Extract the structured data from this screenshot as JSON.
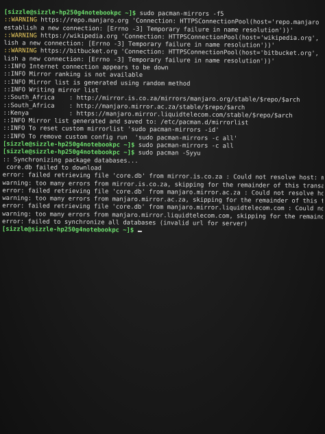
{
  "prompt": {
    "host": "[sizzle@sizzle-hp250g4notebookpc ~]$"
  },
  "commands": {
    "c1": "sudo pacman-mirrors -f5",
    "c2": "sudo pacman-mirrors -c all",
    "c3": "sudo pacman -Syyu"
  },
  "marks": {
    "warning": "::WARNING",
    "info": "::INFO",
    "sync": "::"
  },
  "l": {
    "w1": " https://repo.manjaro.org 'Connection: HTTPSConnectionPool(host='repo.manjaro",
    "w1b": "establish a new connection: [Errno -3] Temporary failure in name resolution'))'",
    "w2": " https://wikipedia.org 'Connection: HTTPSConnectionPool(host='wikipedia.org',",
    "w2b": "lish a new connection: [Errno -3] Temporary failure in name resolution'))'",
    "w3": " https://bitbucket.org 'Connection: HTTPSConnectionPool(host='bitbucket.org',",
    "w3b": "lish a new connection: [Errno -3] Temporary failure in name resolution'))'",
    "i1": " Internet connection appears to be down",
    "i2": " Mirror ranking is not available",
    "i3": " Mirror list is generated using random method",
    "i4": " Writing mirror list",
    "sa1": "::South_Africa    : http://mirror.is.co.za/mirrors/manjaro.org/stable/$repo/$arch",
    "sa2": "::South_Africa    : http://manjaro.mirror.ac.za/stable/$repo/$arch",
    "ke": "::Kenya           : https://manjaro.mirror.liquidtelecom.com/stable/$repo/$arch",
    "i5": " Mirror list generated and saved to: /etc/pacman.d/mirrorlist",
    "i6": " To reset custom mirrorlist 'sudo pacman-mirrors -id'",
    "i7": " To remove custom config run  'sudo pacman-mirrors -c all'",
    "s1": " Synchronizing package databases...",
    "s2": " core.db failed to download",
    "e1": "error: failed retrieving file 'core.db' from mirror.is.co.za : Could not resolve host: mi",
    "e2": "warning: too many errors from mirror.is.co.za, skipping for the remainder of this transac",
    "e3": "error: failed retrieving file 'core.db' from manjaro.mirror.ac.za : Could not resolve hos",
    "e4": "warning: too many errors from manjaro.mirror.ac.za, skipping for the remainder of this tr",
    "e5": "error: failed retrieving file 'core.db' from manjaro.mirror.liquidtelecom.com : Could not",
    "e6": "warning: too many errors from manjaro.mirror.liquidtelecom.com, skipping for the remainder",
    "e7": "error: failed to synchronize all databases (invalid url for server)"
  },
  "colors": {
    "prompt": "#6ee06e",
    "warning": "#f0d060",
    "text": "#dcdcdc",
    "background": "#1a1a1a"
  }
}
